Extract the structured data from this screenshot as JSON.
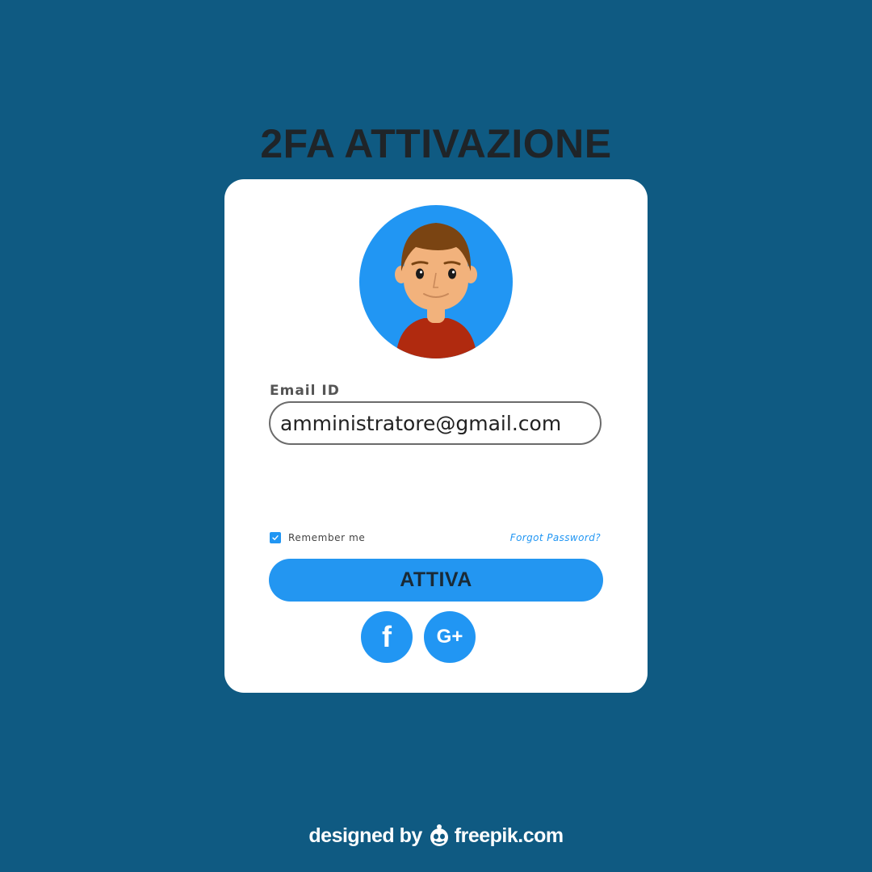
{
  "page": {
    "title": "2FA ATTIVAZIONE",
    "background_color": "#0f5a82",
    "accent_color": "#2196f3"
  },
  "card": {
    "avatar_icon": "user-avatar-icon",
    "email_label": "Email ID",
    "email_value": "amministratore@gmail.com",
    "remember_checked": true,
    "remember_label": "Remember me",
    "forgot_label": "Forgot Password?",
    "submit_label": "ATTIVA",
    "social_buttons": [
      {
        "name": "facebook",
        "glyph": "f"
      },
      {
        "name": "google-plus",
        "glyph": "G+"
      }
    ]
  },
  "footer": {
    "credit_prefix": "designed by",
    "credit_brand": "freepik.com"
  }
}
